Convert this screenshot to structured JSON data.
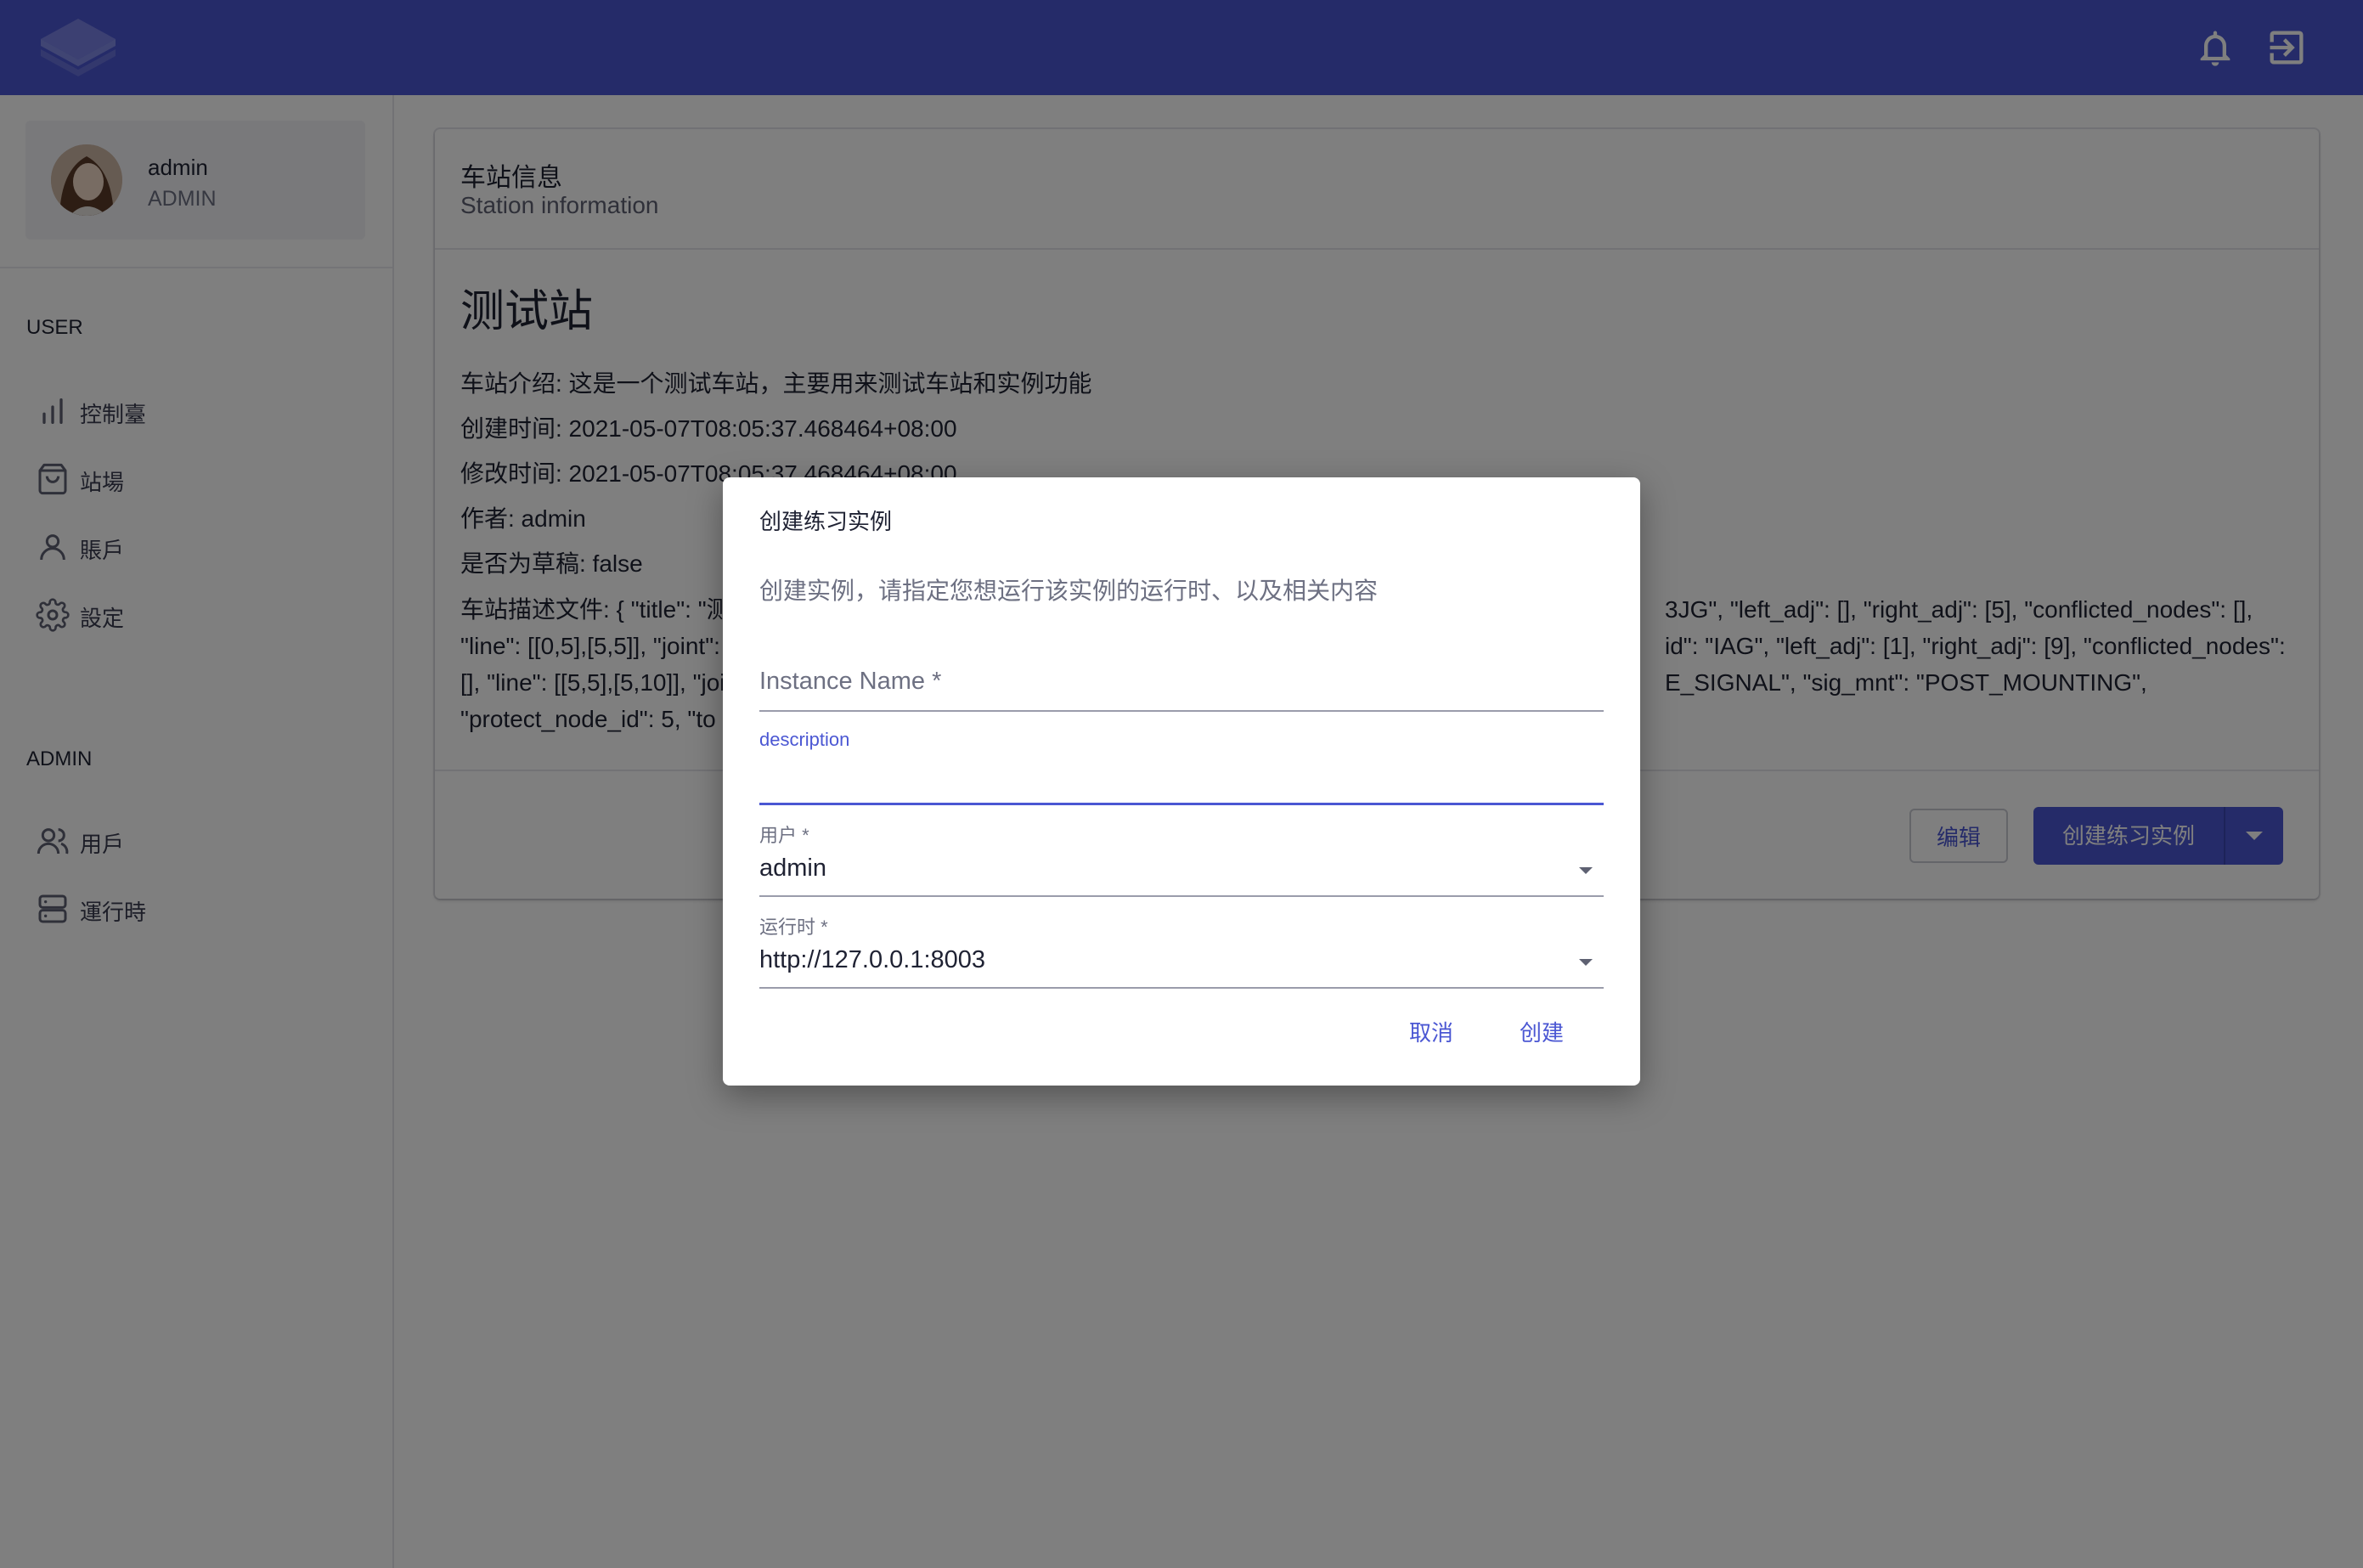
{
  "header": {
    "logo_icon": "layers-logo-icon",
    "notifications_icon": "bell-icon",
    "logout_icon": "exit-icon",
    "brand_color": "#4b57d3"
  },
  "sidebar": {
    "user": {
      "name": "admin",
      "role": "ADMIN"
    },
    "sections": {
      "user": "USER",
      "admin": "ADMIN"
    },
    "user_items": [
      {
        "label": "控制臺",
        "icon": "bar-chart-icon"
      },
      {
        "label": "站場",
        "icon": "shopping-bag-icon"
      },
      {
        "label": "賬戶",
        "icon": "person-icon"
      },
      {
        "label": "設定",
        "icon": "gear-icon"
      }
    ],
    "admin_items": [
      {
        "label": "用戶",
        "icon": "people-icon"
      },
      {
        "label": "運行時",
        "icon": "server-icon"
      }
    ]
  },
  "station": {
    "header_title": "车站信息",
    "header_subtitle": "Station information",
    "name": "测试站",
    "intro": "车站介绍: 这是一个测试车站，主要用来测试车站和实例功能",
    "created": "创建时间: 2021-05-07T08:05:37.468464+08:00",
    "modified": "修改时间: 2021-05-07T08:05:37.468464+08:00",
    "author": "作者: admin",
    "draft": "是否为草稿: false",
    "desc_lines": [
      "车站描述文件: { \"title\": \"测",
      "\"line\": [[0,5],[5,5]], \"joint\":",
      "[], \"line\": [[5,5],[5,10]], \"joi",
      "\"protect_node_id\": 5, \"to"
    ],
    "desc_lines_right": [
      "3JG\", \"left_adj\": [], \"right_adj\": [5], \"conflicted_nodes\": [],",
      "id\": \"IAG\", \"left_adj\": [1], \"right_adj\": [9], \"conflicted_nodes\":",
      "E_SIGNAL\", \"sig_mnt\": \"POST_MOUNTING\",",
      ""
    ],
    "edit_label": "编辑",
    "create_label": "创建练习实例",
    "dropdown_icon": "caret-down-icon"
  },
  "dialog": {
    "title": "创建练习实例",
    "description": "创建实例，请指定您想运行该实例的运行时、以及相关内容",
    "instance_name_label": "Instance Name *",
    "description_label": "description",
    "description_value": "",
    "user_label": "用户 *",
    "user_value": "admin",
    "runtime_label": "运行时 *",
    "runtime_value": "http://127.0.0.1:8003",
    "cancel_label": "取消",
    "create_label": "创建"
  }
}
